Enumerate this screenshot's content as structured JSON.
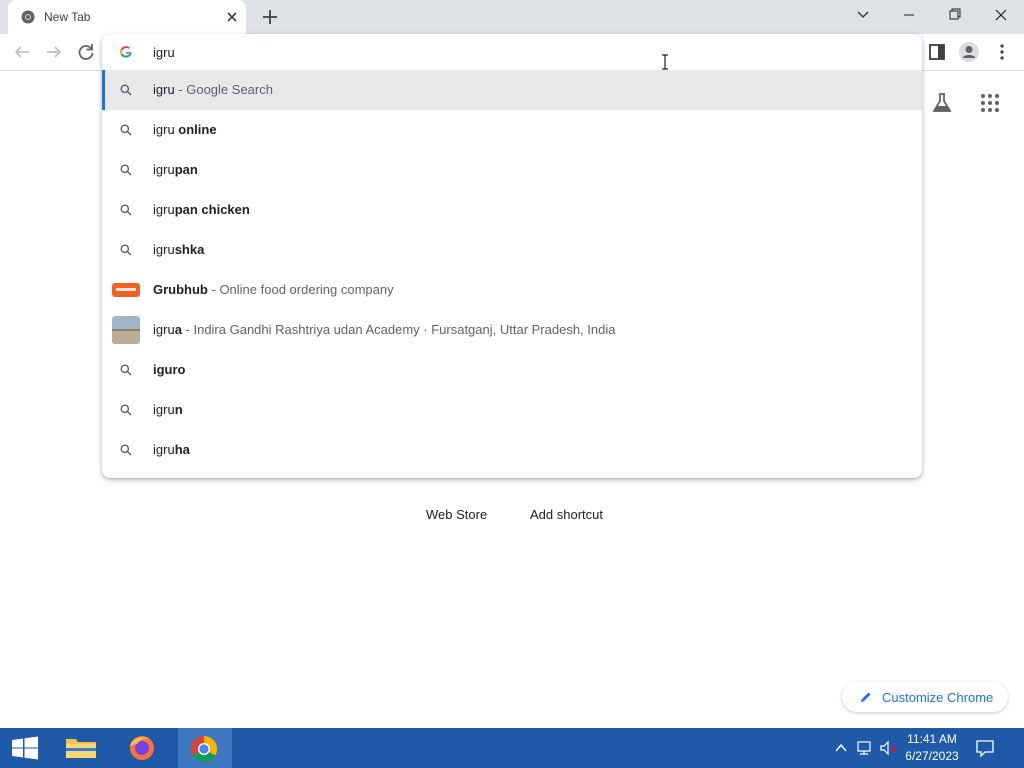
{
  "window": {
    "tab_title": "New Tab"
  },
  "omnibox": {
    "input_value": "igru",
    "suggestions": [
      {
        "type": "search",
        "prefix": "igru",
        "bold": "",
        "desc": " - Google Search",
        "selected": true
      },
      {
        "type": "search",
        "prefix": "igru ",
        "bold": "online",
        "desc": ""
      },
      {
        "type": "search",
        "prefix": "igru",
        "bold": "pan",
        "desc": ""
      },
      {
        "type": "search",
        "prefix": "igru",
        "bold": "pan chicken",
        "desc": ""
      },
      {
        "type": "search",
        "prefix": "igru",
        "bold": "shka",
        "desc": ""
      },
      {
        "type": "entity",
        "prefix": "",
        "bold": "Grubhub",
        "desc": " - Online food ordering company"
      },
      {
        "type": "entity",
        "prefix": "igru",
        "bold": "a",
        "desc": " - Indira Gandhi Rashtriya udan Academy · Fursatganj, Uttar Pradesh, India"
      },
      {
        "type": "search",
        "prefix": "",
        "bold": "iguro",
        "desc": ""
      },
      {
        "type": "search",
        "prefix": "igru",
        "bold": "n",
        "desc": ""
      },
      {
        "type": "search",
        "prefix": "igru",
        "bold": "ha",
        "desc": ""
      }
    ]
  },
  "ntp": {
    "shortcut_webstore": "Web Store",
    "shortcut_add": "Add shortcut",
    "customize_label": "Customize Chrome"
  },
  "taskbar": {
    "time": "11:41 AM",
    "date": "6/27/2023"
  },
  "colors": {
    "accent": "#1a73e8",
    "taskbar": "#1e5aa8"
  }
}
